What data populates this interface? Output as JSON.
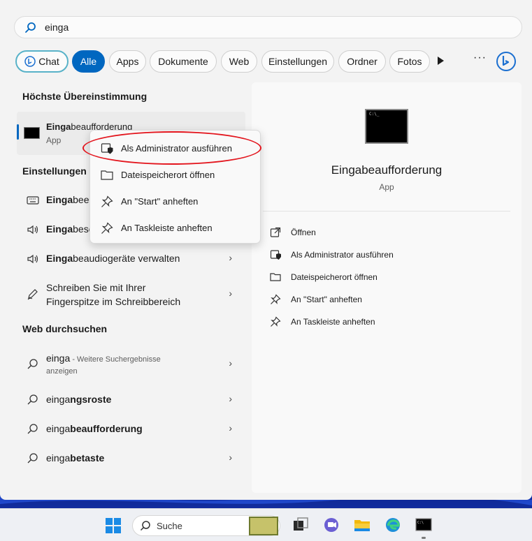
{
  "search": {
    "query": "einga"
  },
  "filters": {
    "chat": "Chat",
    "items": [
      "Alle",
      "Apps",
      "Dokumente",
      "Web",
      "Einstellungen",
      "Ordner",
      "Fotos"
    ]
  },
  "best_match": {
    "title": "Höchste Übereinstimmung",
    "name_bold": "Einga",
    "name_rest": "beaufforderung",
    "type": "App"
  },
  "settings": {
    "title": "Einstellungen",
    "items": [
      {
        "bold": "Einga",
        "rest": "beei"
      },
      {
        "bold": "Einga",
        "rest": "besc"
      },
      {
        "bold": "Einga",
        "rest": "beaudiogeräte verwalten"
      },
      {
        "line1": "Schreiben Sie mit Ihrer",
        "line2": "Fingerspitze im Schreibbereich"
      }
    ]
  },
  "web": {
    "title": "Web durchsuchen",
    "items": [
      {
        "text": "einga",
        "hint": " - Weitere Suchergebnisse",
        "hint2": "anzeigen"
      },
      {
        "plain": "einga",
        "bold": "ngsroste"
      },
      {
        "plain": "einga",
        "bold": "beaufforderung"
      },
      {
        "plain": "einga",
        "bold": "betaste"
      }
    ]
  },
  "context_menu": [
    "Als Administrator ausführen",
    "Dateispeicherort öffnen",
    "An \"Start\" anheften",
    "An Taskleiste anheften"
  ],
  "detail": {
    "title": "Eingabeaufforderung",
    "type": "App",
    "actions": [
      "Öffnen",
      "Als Administrator ausführen",
      "Dateispeicherort öffnen",
      "An \"Start\" anheften",
      "An Taskleiste anheften"
    ]
  },
  "taskbar": {
    "search_label": "Suche"
  },
  "colors": {
    "accent": "#0067c0",
    "highlight_ring": "#e3151d"
  }
}
